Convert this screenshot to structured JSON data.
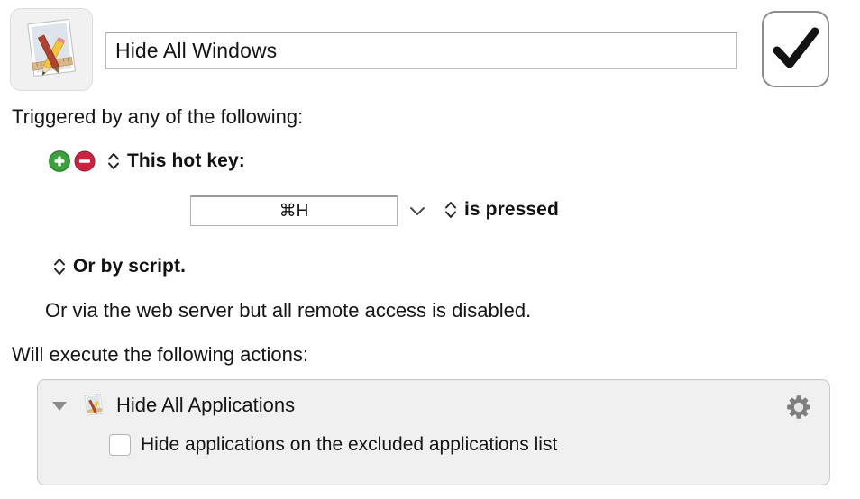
{
  "header": {
    "macro_icon": "macro-app-icon",
    "macro_name_value": "Hide All Windows",
    "macro_name_placeholder": "Macro Name",
    "enabled_toggle_icon": "checkmark-icon"
  },
  "trigger_section": {
    "heading": "Triggered by any of the following:",
    "add_button_icon": "plus-circle-icon",
    "remove_button_icon": "minus-circle-icon",
    "hotkey_trigger_label": "This hot key:",
    "hotkey_value": "⌘H",
    "hotkey_dropdown_icon": "chevron-down-icon",
    "hotkey_condition_label": "is pressed",
    "script_trigger_label": "Or by script.",
    "webserver_note": "Or via the web server but all remote access is disabled.",
    "stepper_icon": "up-down-stepper-icon"
  },
  "actions_section": {
    "heading": "Will execute the following actions:",
    "actions": [
      {
        "disclosure_icon": "disclosure-triangle-down-icon",
        "action_icon": "macro-app-icon",
        "title": "Hide All Applications",
        "gear_icon": "gear-icon",
        "options": [
          {
            "label": "Hide applications on the excluded applications list",
            "checked": false
          }
        ]
      }
    ]
  },
  "colors": {
    "add_green": "#3ba13c",
    "remove_red": "#c9243f",
    "panel_background": "#f0f0f0",
    "panel_border": "#c8c8c8",
    "text": "#151515",
    "gear_gray": "#7e7e7e",
    "triangle_gray": "#8b8b8b"
  }
}
